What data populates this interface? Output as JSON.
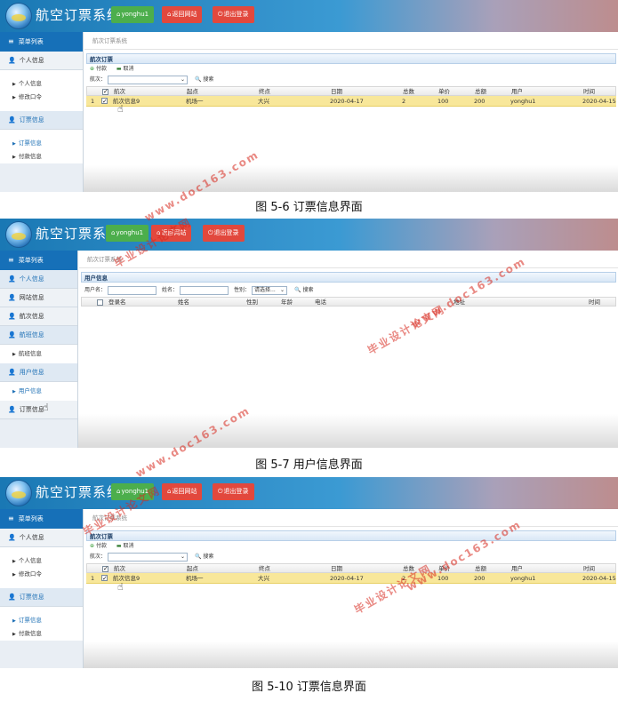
{
  "app": {
    "title": "航空订票系统",
    "user_button": "yonghu1",
    "back_button": "返回网站",
    "logout_button": "退出登录"
  },
  "sidebar": {
    "header": "菜单列表",
    "booking_menu": [
      {
        "label": "个人信息",
        "type": "group"
      },
      {
        "label": "个人信息",
        "type": "item"
      },
      {
        "label": "修改口令",
        "type": "item"
      },
      {
        "label": "订票信息",
        "type": "group"
      },
      {
        "label": "订票信息",
        "type": "item"
      },
      {
        "label": "付款信息",
        "type": "item"
      }
    ],
    "user_menu": [
      {
        "label": "个人信息",
        "type": "group"
      },
      {
        "label": "网站信息",
        "type": "group"
      },
      {
        "label": "航次信息",
        "type": "group"
      },
      {
        "label": "航班信息",
        "type": "group"
      },
      {
        "label": "航班信息",
        "type": "item"
      },
      {
        "label": "用户信息",
        "type": "group"
      },
      {
        "label": "用户信息",
        "type": "item"
      },
      {
        "label": "订票信息",
        "type": "group"
      }
    ]
  },
  "breadcrumb": "航次订票系统",
  "booking_view": {
    "panel_title": "航次订票",
    "toolbar": {
      "pay": "付款",
      "cancel": "取消"
    },
    "search": {
      "label": "航次：",
      "button": "搜索"
    },
    "columns": [
      "航次",
      "起点",
      "终点",
      "日期",
      "总数",
      "单价",
      "总额",
      "用户",
      "时间"
    ],
    "rows": [
      {
        "index": "1",
        "flight": "航次信息9",
        "origin": "机场一",
        "destination": "大兴",
        "date": "2020-04-17",
        "count": "2",
        "price": "100",
        "total": "200",
        "user": "yonghu1",
        "time": "2020-04-15"
      }
    ]
  },
  "user_view": {
    "panel_title": "用户信息",
    "search": {
      "username_label": "用户名：",
      "name_label": "姓名：",
      "gender_label": "性别：",
      "gender_placeholder": "请选择...",
      "button": "搜索"
    },
    "columns": [
      "登录名",
      "姓名",
      "性别",
      "年龄",
      "电话",
      "地址",
      "时间"
    ]
  },
  "captions": [
    "图 5-6 订票信息界面",
    "图 5-7 用户信息界面",
    "图 5-10 订票信息界面"
  ],
  "watermarks": {
    "site": "www.doc163.com",
    "name": "毕业设计论文网"
  }
}
